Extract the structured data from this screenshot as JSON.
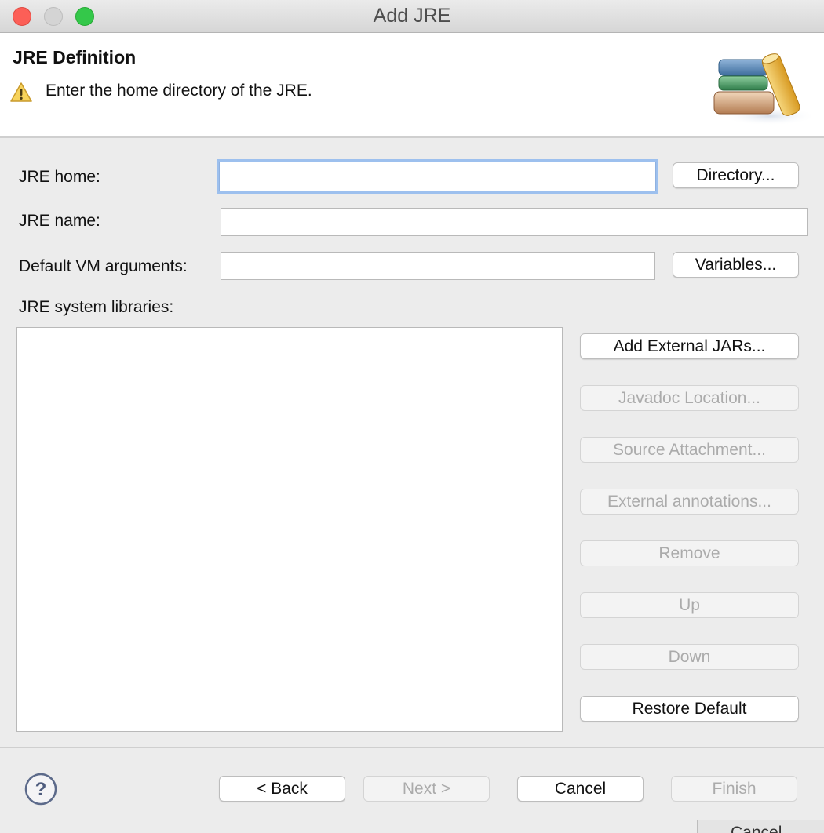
{
  "window": {
    "title": "Add JRE"
  },
  "banner": {
    "title": "JRE Definition",
    "message": "Enter the home directory of the JRE.",
    "message_icon": "warning-icon",
    "graphic_icon": "jre-library-books-icon"
  },
  "form": {
    "jre_home_label": "JRE home:",
    "jre_home_value": "",
    "directory_button": "Directory...",
    "jre_name_label": "JRE name:",
    "jre_name_value": "",
    "vm_args_label": "Default VM arguments:",
    "vm_args_value": "",
    "variables_button": "Variables...",
    "libraries_label": "JRE system libraries:"
  },
  "library_buttons": {
    "add_external_jars": "Add External JARs...",
    "javadoc_location": "Javadoc Location...",
    "source_attachment": "Source Attachment...",
    "external_annotations": "External annotations...",
    "remove": "Remove",
    "up": "Up",
    "down": "Down",
    "restore_default": "Restore Default"
  },
  "footer": {
    "help_icon": "help-icon",
    "back": "< Back",
    "next": "Next >",
    "cancel": "Cancel",
    "finish": "Finish"
  },
  "background_window": {
    "partial_text": "Cancel"
  },
  "colors": {
    "close": "#fc5f57",
    "minimize": "#d4d4d4",
    "maximize": "#34c84a",
    "focus_ring": "#9dc0ee",
    "disabled_text": "#ababab"
  }
}
